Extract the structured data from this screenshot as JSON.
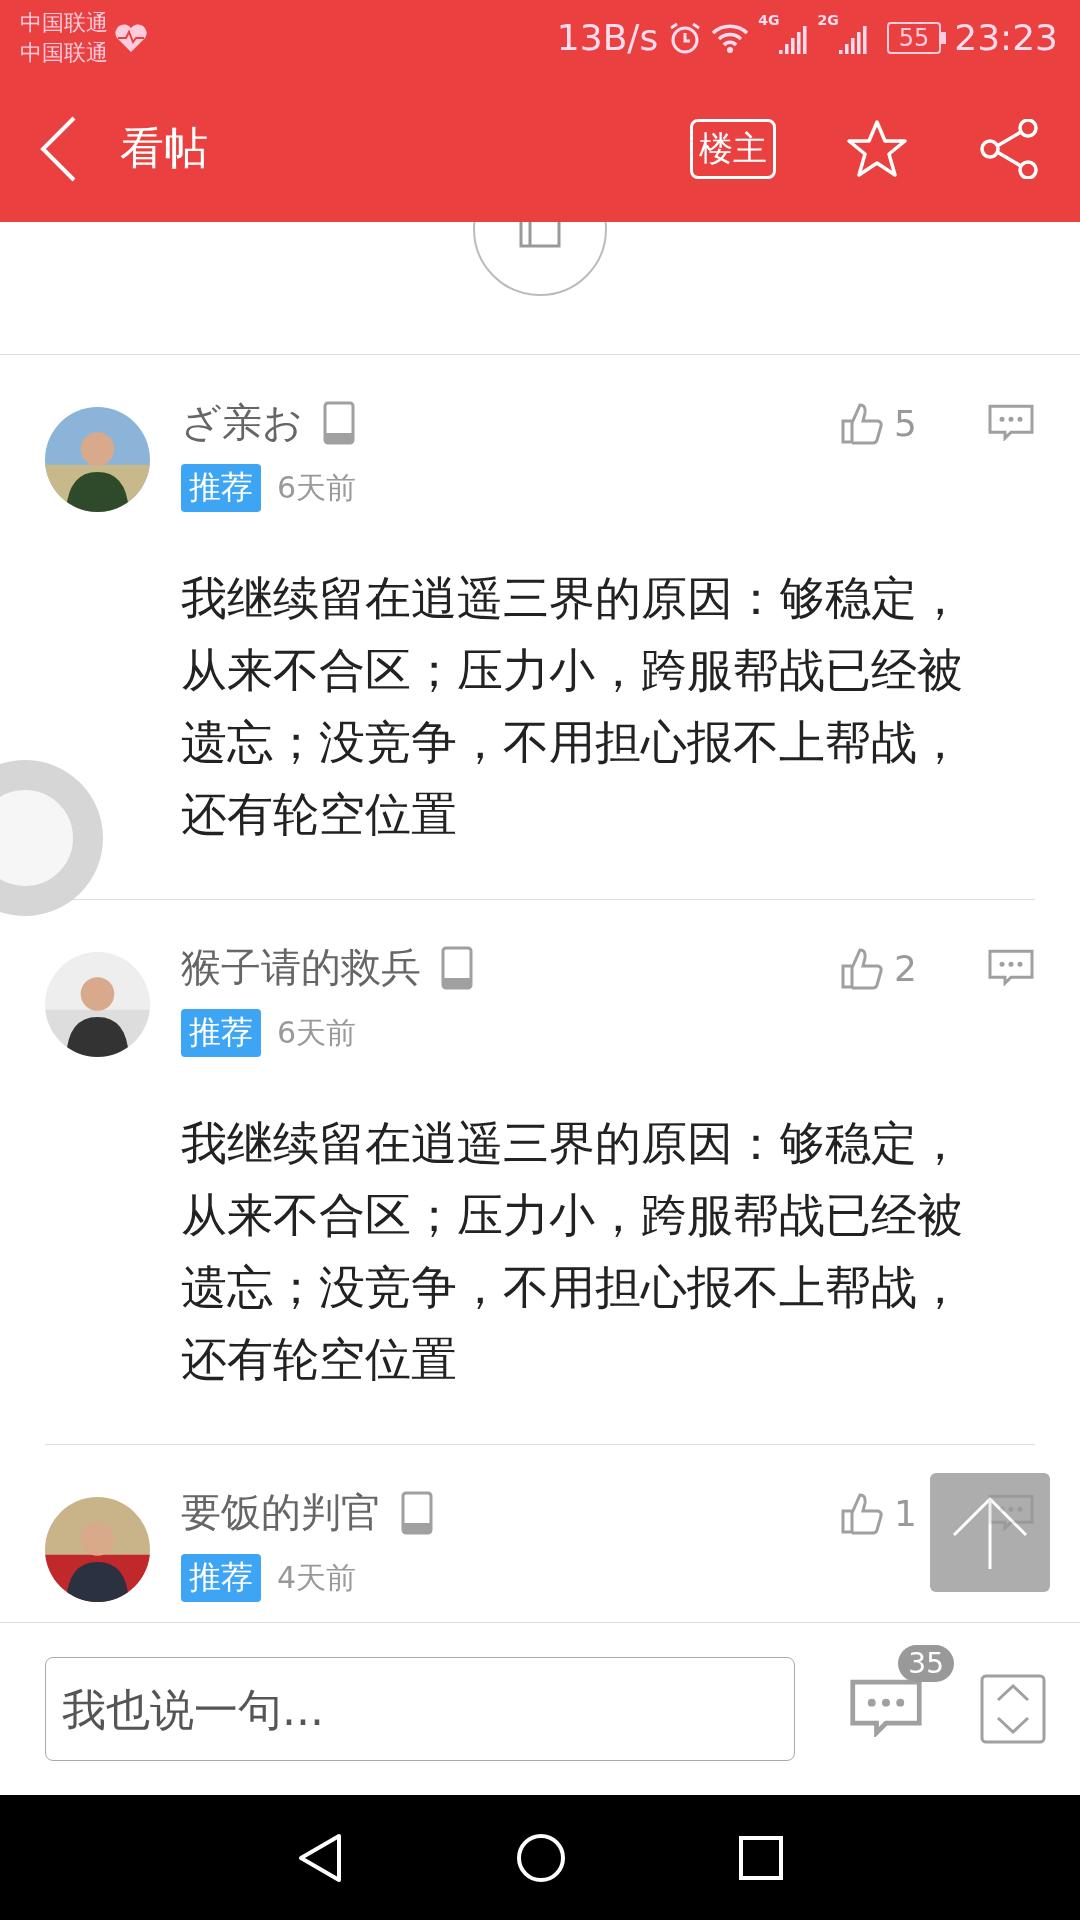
{
  "status_bar": {
    "carriers": [
      "中国联通",
      "中国联通"
    ],
    "speed": "13B/s",
    "networks": [
      "4G",
      "2G"
    ],
    "battery": "55",
    "time": "23:23"
  },
  "header": {
    "title": "看帖",
    "author_button": "楼主"
  },
  "comments": [
    {
      "name": "ざ亲お",
      "badge": "推荐",
      "time": "6天前",
      "likes": "5",
      "body": "我继续留在逍遥三界的原因：够稳定，从来不合区；压力小，跨服帮战已经被遗忘；没竞争，不用担心报不上帮战，还有轮空位置"
    },
    {
      "name": "猴子请的救兵",
      "badge": "推荐",
      "time": "6天前",
      "likes": "2",
      "body": "我继续留在逍遥三界的原因：够稳定，从来不合区；压力小，跨服帮战已经被遗忘；没竞争，不用担心报不上帮战，还有轮空位置"
    },
    {
      "name": "要饭的判官",
      "badge": "推荐",
      "time": "4天前",
      "likes": "1"
    }
  ],
  "reply_bar": {
    "placeholder": "我也说一句...",
    "comment_count": "35"
  }
}
